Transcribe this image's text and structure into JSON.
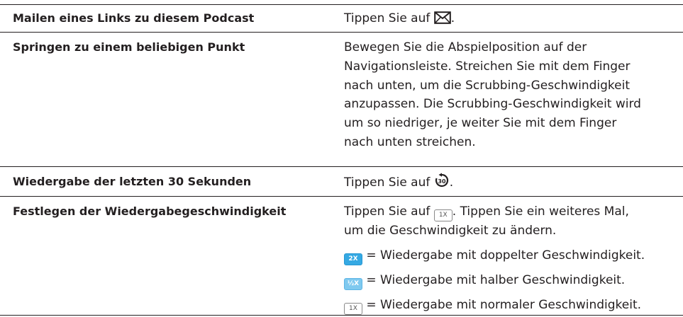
{
  "rows": [
    {
      "label": "Mailen eines Links zu diesem Podcast",
      "pre": "Tippen Sie auf ",
      "icon": "mail-icon",
      "post": "."
    },
    {
      "label": "Springen zu einem beliebigen Punkt",
      "lines": [
        "Bewegen Sie die Abspielposition auf der",
        "Navigationsleiste. Streichen Sie mit dem Finger",
        "nach unten, um die Scrubbing-Geschwindigkeit",
        "anzupassen. Die Scrubbing-Geschwindigkeit wird",
        "um so niedriger, je weiter Sie mit dem Finger",
        "nach unten streichen."
      ]
    },
    {
      "label": "Wiedergabe der letzten 30 Sekunden",
      "pre": "Tippen Sie auf ",
      "icon": "skip-back-30-icon",
      "icon_text": "30",
      "post": "."
    },
    {
      "label": "Festlegen der Wiedergabegeschwindigkeit",
      "line1_pre": "Tippen Sie auf ",
      "badge_1x": "1X",
      "line1_post": ". Tippen Sie ein weiteres Mal,",
      "line2": "um die Geschwindigkeit zu ändern.",
      "speeds": [
        {
          "badge": "2X",
          "text": " = Wiedergabe mit doppelter Geschwindigkeit.",
          "style": "blue"
        },
        {
          "badge": "½X",
          "text": " = Wiedergabe mit halber Geschwindigkeit.",
          "style": "half"
        },
        {
          "badge": "1X",
          "text": " = Wiedergabe mit normaler Geschwindigkeit.",
          "style": "outline"
        }
      ]
    }
  ],
  "colors": {
    "text": "#231f20",
    "badge_blue": "#35a9e3",
    "badge_half": "#7fc9ef"
  }
}
